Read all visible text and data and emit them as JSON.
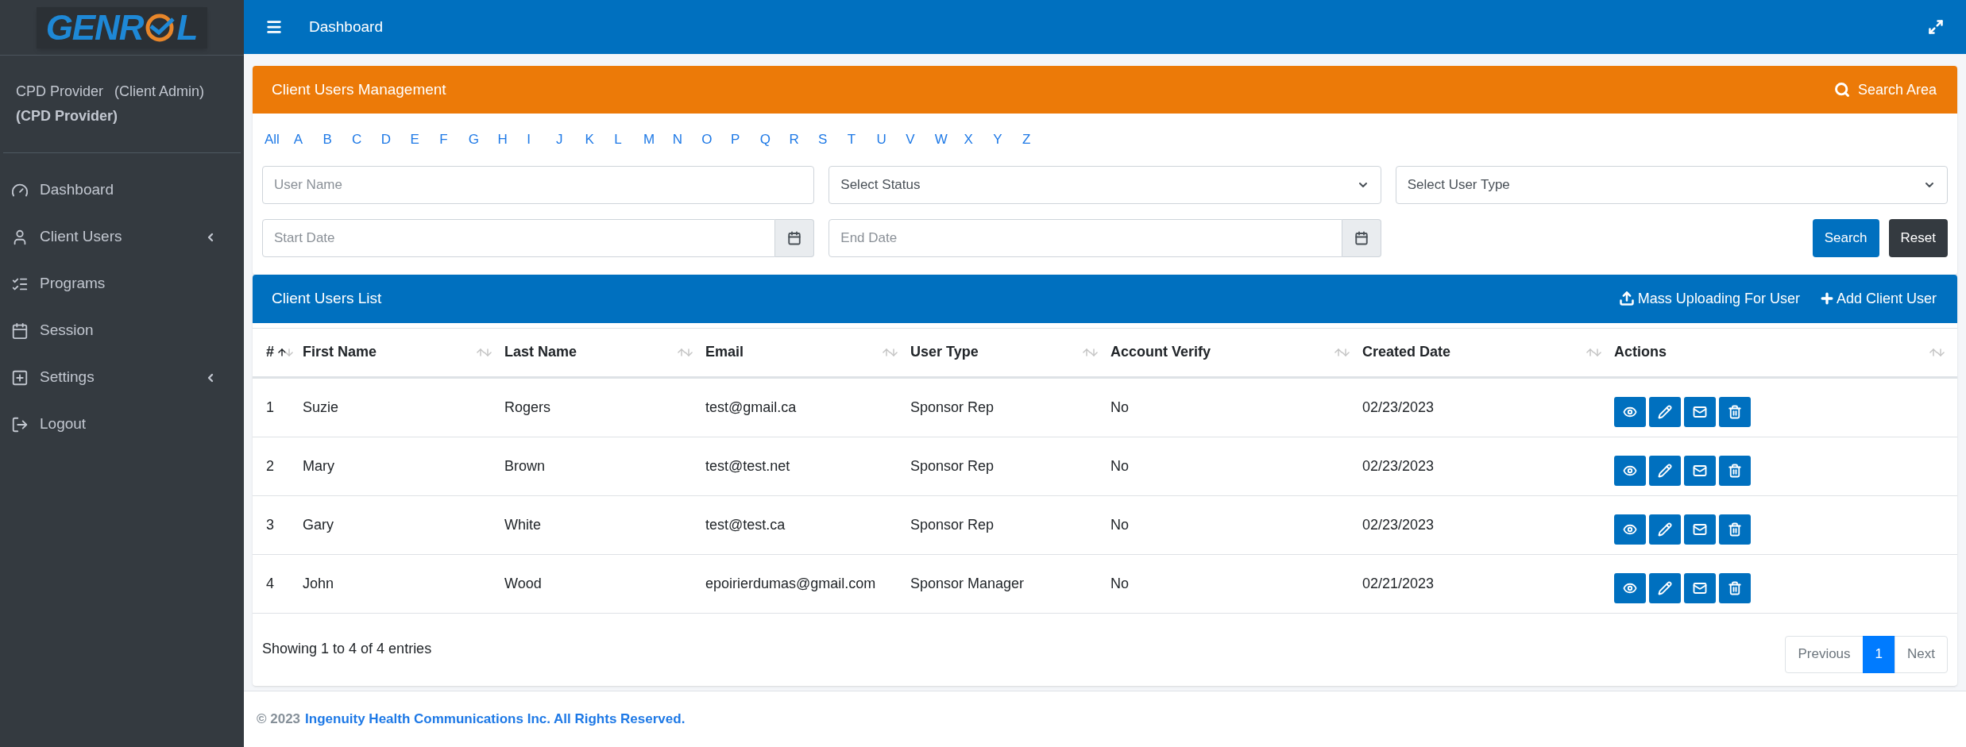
{
  "logo": {
    "text_start": "GENR",
    "text_end": "L"
  },
  "user": {
    "name": "CPD Provider",
    "role": "(Client Admin)",
    "org": "(CPD Provider)"
  },
  "sidebar": {
    "items": [
      {
        "label": "Dashboard",
        "expandable": false
      },
      {
        "label": "Client Users",
        "expandable": true
      },
      {
        "label": "Programs",
        "expandable": false
      },
      {
        "label": "Session",
        "expandable": false
      },
      {
        "label": "Settings",
        "expandable": true
      },
      {
        "label": "Logout",
        "expandable": false
      }
    ]
  },
  "topbar": {
    "title": "Dashboard"
  },
  "management": {
    "title": "Client Users Management",
    "search_area": "Search Area",
    "letters": [
      "All",
      "A",
      "B",
      "C",
      "D",
      "E",
      "F",
      "G",
      "H",
      "I",
      "J",
      "K",
      "L",
      "M",
      "N",
      "O",
      "P",
      "Q",
      "R",
      "S",
      "T",
      "U",
      "V",
      "W",
      "X",
      "Y",
      "Z"
    ],
    "user_name": {
      "placeholder": "User Name"
    },
    "status": {
      "value": "Select Status"
    },
    "user_type": {
      "value": "Select User Type"
    },
    "start_date": {
      "placeholder": "Start Date"
    },
    "end_date": {
      "placeholder": "End Date"
    },
    "buttons": [
      {
        "label": "Search",
        "kind": "primary"
      },
      {
        "label": "Reset",
        "kind": "dark"
      }
    ]
  },
  "list": {
    "title": "Client Users List",
    "mass_upload": "Mass Uploading For User",
    "add_user": "Add Client User",
    "columns": [
      {
        "label": "#",
        "sorted": true
      },
      {
        "label": "First Name",
        "sorted": false
      },
      {
        "label": "Last Name",
        "sorted": false
      },
      {
        "label": "Email",
        "sorted": false
      },
      {
        "label": "User Type",
        "sorted": false
      },
      {
        "label": "Account Verify",
        "sorted": false
      },
      {
        "label": "Created Date",
        "sorted": false
      },
      {
        "label": "Actions",
        "sorted": false
      }
    ],
    "rows": [
      {
        "cells": [
          "1",
          "Suzie",
          "Rogers",
          "test@gmail.ca",
          "Sponsor Rep",
          "No",
          "02/23/2023"
        ]
      },
      {
        "cells": [
          "2",
          "Mary",
          "Brown",
          "test@test.net",
          "Sponsor Rep",
          "No",
          "02/23/2023"
        ]
      },
      {
        "cells": [
          "3",
          "Gary",
          "White",
          "test@test.ca",
          "Sponsor Rep",
          "No",
          "02/23/2023"
        ]
      },
      {
        "cells": [
          "4",
          "John",
          "Wood",
          "epoirierdumas@gmail.com",
          "Sponsor Manager",
          "No",
          "02/21/2023"
        ]
      }
    ],
    "info": "Showing 1 to 4 of 4 entries",
    "pagination": [
      {
        "label": "Previous",
        "selected": false
      },
      {
        "label": "1",
        "selected": true
      },
      {
        "label": "Next",
        "selected": false
      }
    ]
  },
  "footer": {
    "copyright": "© 2023",
    "company": "Ingenuity Health Communications Inc. All Rights Reserved."
  }
}
